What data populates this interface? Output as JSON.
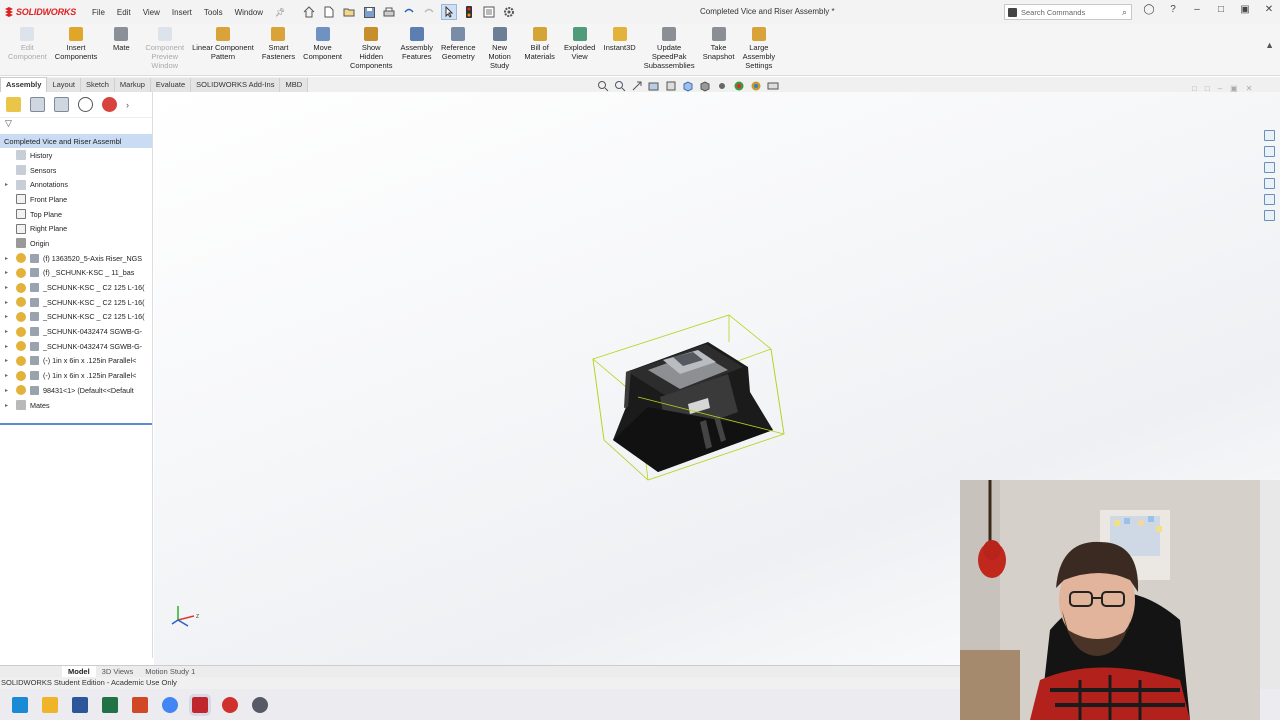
{
  "app": {
    "logo_text": "SOLIDWORKS",
    "document_title": "Completed Vice and Riser Assembly *",
    "menus": [
      "File",
      "Edit",
      "View",
      "Insert",
      "Tools",
      "Window"
    ],
    "search_placeholder": "Search Commands"
  },
  "commands": [
    {
      "label": "Edit\nComponent",
      "disabled": true,
      "icon": "edit-component-icon",
      "color": "#b0c4d8"
    },
    {
      "label": "Insert\nComponents",
      "disabled": false,
      "icon": "insert-components-icon",
      "color": "#e0a62a"
    },
    {
      "label": "Mate",
      "disabled": false,
      "icon": "mate-icon",
      "color": "#8a8f98"
    },
    {
      "label": "Component\nPreview\nWindow",
      "disabled": true,
      "icon": "preview-window-icon",
      "color": "#b0c4d8"
    },
    {
      "label": "Linear Component\nPattern",
      "disabled": false,
      "icon": "linear-pattern-icon",
      "color": "#d9a33a"
    },
    {
      "label": "Smart\nFasteners",
      "disabled": false,
      "icon": "smart-fasteners-icon",
      "color": "#d9a33a"
    },
    {
      "label": "Move\nComponent",
      "disabled": false,
      "icon": "move-component-icon",
      "color": "#6f92c2"
    },
    {
      "label": "Show\nHidden\nComponents",
      "disabled": false,
      "icon": "show-hidden-icon",
      "color": "#c78f2c"
    },
    {
      "label": "Assembly\nFeatures",
      "disabled": false,
      "icon": "assembly-features-icon",
      "color": "#5b7fb0"
    },
    {
      "label": "Reference\nGeometry",
      "disabled": false,
      "icon": "reference-geometry-icon",
      "color": "#7a8da6"
    },
    {
      "label": "New\nMotion\nStudy",
      "disabled": false,
      "icon": "motion-study-icon",
      "color": "#6d7f97"
    },
    {
      "label": "Bill of\nMaterials",
      "disabled": false,
      "icon": "bill-of-materials-icon",
      "color": "#d4a536"
    },
    {
      "label": "Exploded\nView",
      "disabled": false,
      "icon": "exploded-view-icon",
      "color": "#4f9b7a"
    },
    {
      "label": "Instant3D",
      "disabled": false,
      "icon": "instant3d-icon",
      "color": "#e2b23a"
    },
    {
      "label": "Update\nSpeedPak\nSubassemblies",
      "disabled": false,
      "icon": "speedpak-icon",
      "color": "#8b8f95"
    },
    {
      "label": "Take\nSnapshot",
      "disabled": false,
      "icon": "snapshot-icon",
      "color": "#8b8f95"
    },
    {
      "label": "Large\nAssembly\nSettings",
      "disabled": false,
      "icon": "large-assembly-icon",
      "color": "#d9a33a"
    }
  ],
  "tabs": [
    "Assembly",
    "Layout",
    "Sketch",
    "Markup",
    "Evaluate",
    "SOLIDWORKS Add-Ins",
    "MBD"
  ],
  "active_tab": "Assembly",
  "tree": {
    "root": "Completed Vice and Riser Assembl",
    "items": [
      {
        "label": "History",
        "type": "folder",
        "expand": false
      },
      {
        "label": "Sensors",
        "type": "folder",
        "expand": false
      },
      {
        "label": "Annotations",
        "type": "folder",
        "expand": true
      },
      {
        "label": "Front Plane",
        "type": "plane",
        "expand": false
      },
      {
        "label": "Top Plane",
        "type": "plane",
        "expand": false
      },
      {
        "label": "Right Plane",
        "type": "plane",
        "expand": false
      },
      {
        "label": "Origin",
        "type": "origin",
        "expand": false
      },
      {
        "label": "(f) 1363520_5-Axis Riser_NGS",
        "type": "part",
        "expand": true
      },
      {
        "label": "(f) _SCHUNK-KSC _ 11_bas",
        "type": "part",
        "expand": true
      },
      {
        "label": "_SCHUNK-KSC _ C2 125 L-16(",
        "type": "part",
        "expand": true
      },
      {
        "label": "_SCHUNK-KSC _ C2 125 L-16(",
        "type": "part",
        "expand": true
      },
      {
        "label": "_SCHUNK-KSC _ C2 125 L-16(",
        "type": "part",
        "expand": true
      },
      {
        "label": "_SCHUNK-0432474 SGWB-G-",
        "type": "part",
        "expand": true
      },
      {
        "label": "_SCHUNK-0432474 SGWB-G-",
        "type": "part",
        "expand": true
      },
      {
        "label": "(-) 1in x 6in x .125in Parallel<",
        "type": "part",
        "expand": true
      },
      {
        "label": "(-) 1in x 6in x .125in Parallel<",
        "type": "part",
        "expand": true
      },
      {
        "label": "98431<1> (Default<<Default",
        "type": "part",
        "expand": true
      },
      {
        "label": "Mates",
        "type": "mates",
        "expand": true
      }
    ]
  },
  "bottom_tabs": [
    "Model",
    "3D Views",
    "Motion Study 1"
  ],
  "active_bottom_tab": "Model",
  "status": "SOLIDWORKS Student Edition - Academic Use Only",
  "taskbar": [
    {
      "icon": "windows-start-icon",
      "color": "#1a8ad4"
    },
    {
      "icon": "file-explorer-icon",
      "color": "#f0b429"
    },
    {
      "icon": "word-icon",
      "color": "#2b579a"
    },
    {
      "icon": "excel-icon",
      "color": "#217346"
    },
    {
      "icon": "powerpoint-icon",
      "color": "#d24726"
    },
    {
      "icon": "chrome-icon",
      "color": "#4285f4"
    },
    {
      "icon": "solidworks-taskbar-icon",
      "color": "#c0262d"
    },
    {
      "icon": "recorder-icon",
      "color": "#d0312d"
    },
    {
      "icon": "settings-taskbar-icon",
      "color": "#555a66"
    }
  ]
}
